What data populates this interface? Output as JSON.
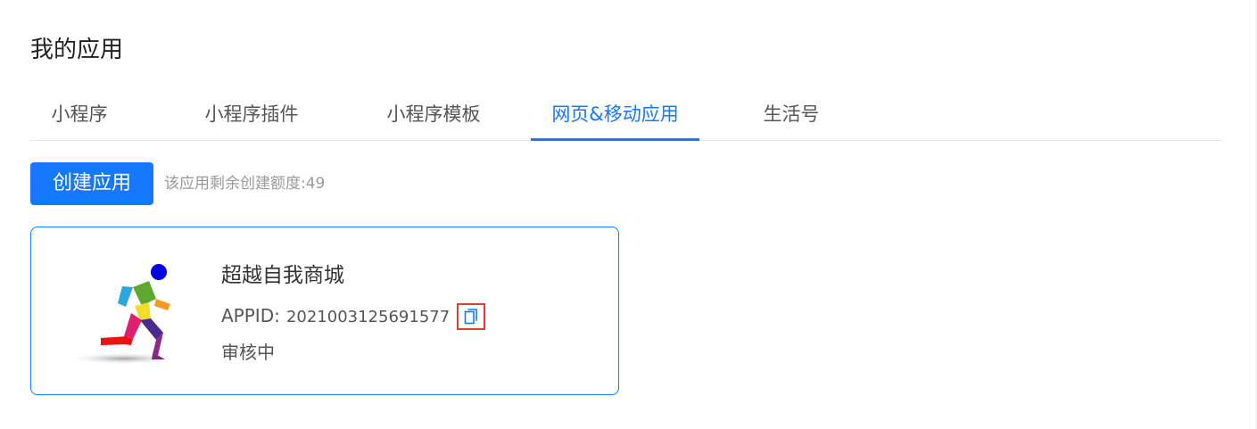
{
  "page": {
    "title": "我的应用"
  },
  "tabs": [
    {
      "label": "小程序",
      "active": false
    },
    {
      "label": "小程序插件",
      "active": false
    },
    {
      "label": "小程序模板",
      "active": false
    },
    {
      "label": "网页&移动应用",
      "active": true
    },
    {
      "label": "生活号",
      "active": false
    }
  ],
  "toolbar": {
    "create_label": "创建应用",
    "quota_text": "该应用剩余创建额度:49"
  },
  "app": {
    "name": "超越自我商城",
    "appid_label": "APPID:",
    "appid_value": "2021003125691577",
    "status": "审核中",
    "logo_icon": "running-man-logo",
    "copy_icon": "copy-icon"
  },
  "colors": {
    "accent": "#1677ff",
    "highlight_border": "#e53935",
    "muted_text": "#999999"
  }
}
